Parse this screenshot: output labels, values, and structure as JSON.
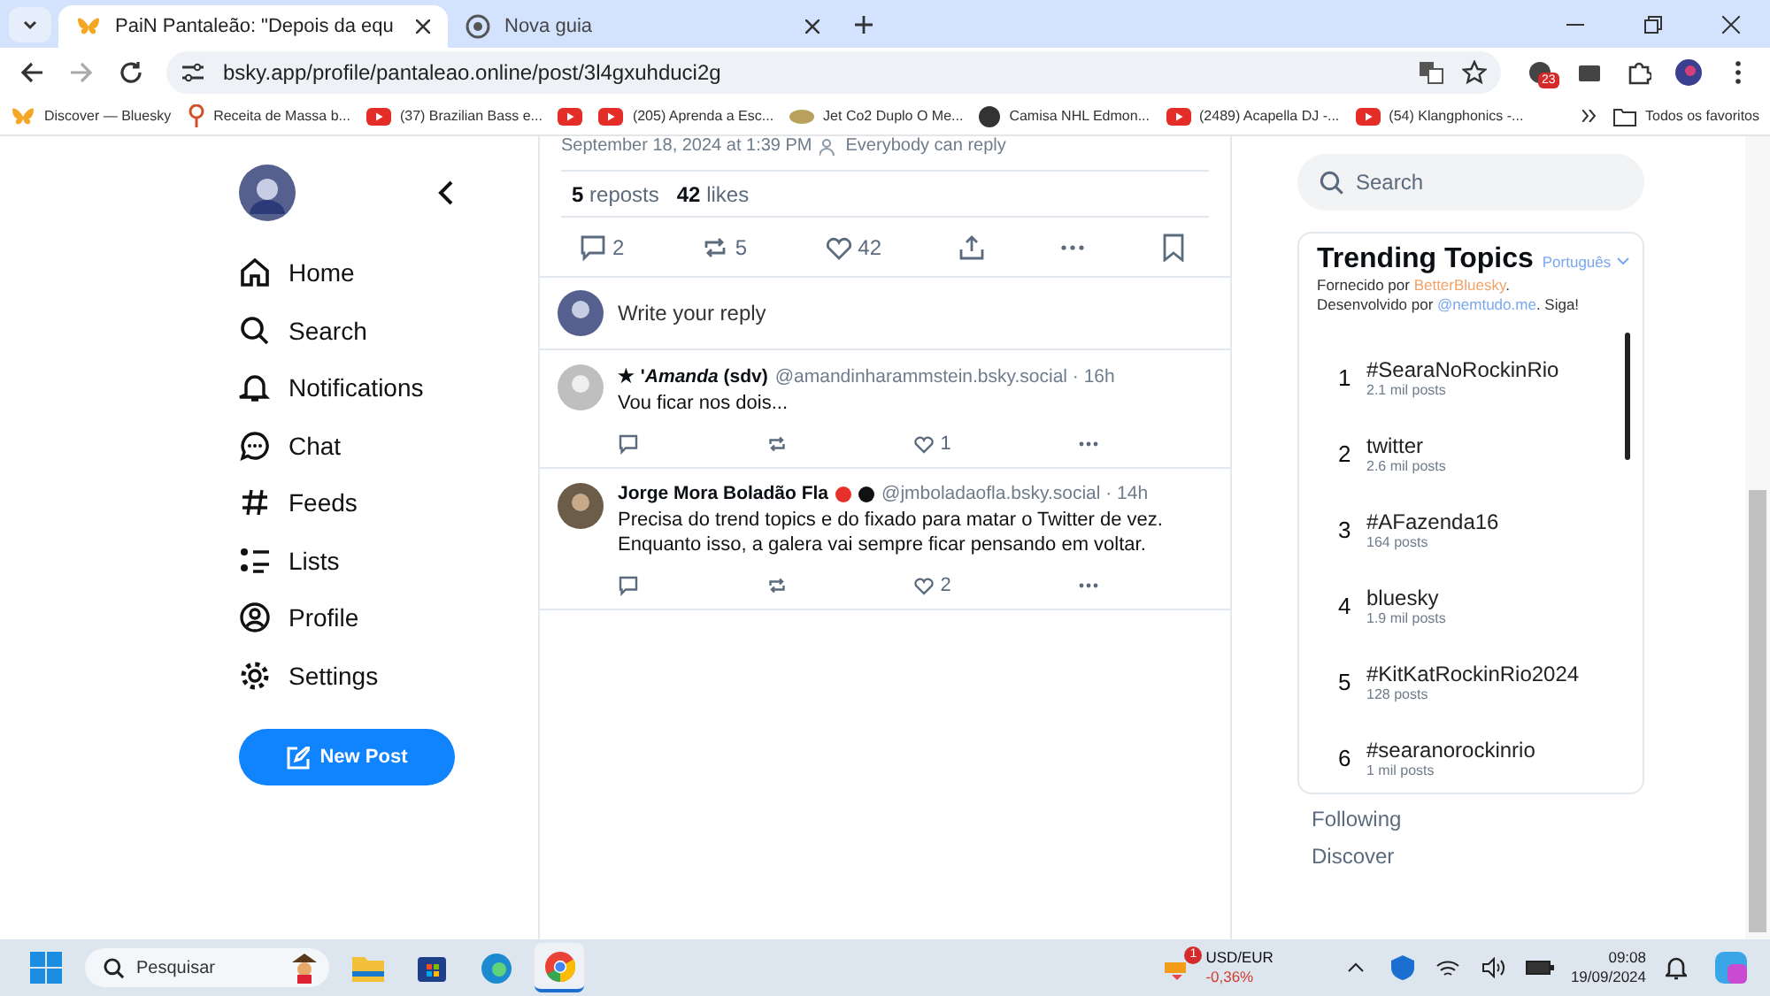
{
  "browser": {
    "tabs": [
      {
        "title": "PaiN Pantaleão: \"Depois da equ",
        "selected": true
      },
      {
        "title": "Nova guia",
        "selected": false
      }
    ],
    "url": "bsky.app/profile/pantaleao.online/post/3l4gxuhduci2g",
    "extension_badge": "23",
    "bookmarks": [
      {
        "label": "Discover — Bluesky"
      },
      {
        "label": "Receita de Massa b..."
      },
      {
        "label": "(37) Brazilian Bass e..."
      },
      {
        "label": "(205) Aprenda a Esc..."
      },
      {
        "label": "Jet Co2 Duplo O Me..."
      },
      {
        "label": "Camisa NHL Edmon..."
      },
      {
        "label": "(2489) Acapella DJ -..."
      },
      {
        "label": "(54) Klangphonics -..."
      }
    ],
    "all_bookmarks": "Todos os favoritos"
  },
  "sidebar": {
    "nav": [
      {
        "label": "Home"
      },
      {
        "label": "Search"
      },
      {
        "label": "Notifications"
      },
      {
        "label": "Chat"
      },
      {
        "label": "Feeds"
      },
      {
        "label": "Lists"
      },
      {
        "label": "Profile"
      },
      {
        "label": "Settings"
      }
    ],
    "new_post": "New Post"
  },
  "post": {
    "meta": "September 18, 2024 at 1:39 PM",
    "reply_setting": "Everybody can reply",
    "reposts_count": "5",
    "reposts_label": "reposts",
    "likes_count": "42",
    "likes_label": "likes",
    "actions": {
      "replies": "2",
      "reposts": "5",
      "likes": "42"
    },
    "reply_placeholder": "Write your reply"
  },
  "replies": [
    {
      "name": "★ '*Amanda* (sdv)",
      "handle": "@amandinharammstein.bsky.social · 16h",
      "text": "Vou ficar nos dois...",
      "likes": "1"
    },
    {
      "name": "Jorge Mora Boladão Fla",
      "dots": [
        {
          "color": "#e8302a"
        },
        {
          "color": "#111111"
        }
      ],
      "handle": "@jmboladaofla.bsky.social · 14h",
      "text": "Precisa do trend topics e do fixado para matar o Twitter de vez. Enquanto isso, a galera vai sempre ficar pensando em voltar.",
      "likes": "2"
    }
  ],
  "right": {
    "search_placeholder": "Search",
    "trending_title": "Trending Topics",
    "language": "Português",
    "credit_1": {
      "before": "Fornecido por ",
      "link": "BetterBluesky",
      "after": "."
    },
    "credit_2": {
      "before": "Desenvolvido por ",
      "link": "@nemtudo.me",
      "after": ". Siga!"
    },
    "topics": [
      {
        "rank": "1",
        "tag": "#SearaNoRockinRio",
        "posts": "2.1 mil posts"
      },
      {
        "rank": "2",
        "tag": "twitter",
        "posts": "2.6 mil posts"
      },
      {
        "rank": "3",
        "tag": "#AFazenda16",
        "posts": "164 posts"
      },
      {
        "rank": "4",
        "tag": "bluesky",
        "posts": "1.9 mil posts"
      },
      {
        "rank": "5",
        "tag": "#KitKatRockinRio2024",
        "posts": "128 posts"
      },
      {
        "rank": "6",
        "tag": "#searanorockinrio",
        "posts": "1 mil posts"
      }
    ],
    "feeds": [
      {
        "label": "Following"
      },
      {
        "label": "Discover"
      }
    ]
  },
  "taskbar": {
    "search_placeholder": "Pesquisar",
    "ticker": "USD/EUR",
    "change": "-0,36%",
    "ticker_badge": "1",
    "time": "09:08",
    "date": "19/09/2024"
  }
}
